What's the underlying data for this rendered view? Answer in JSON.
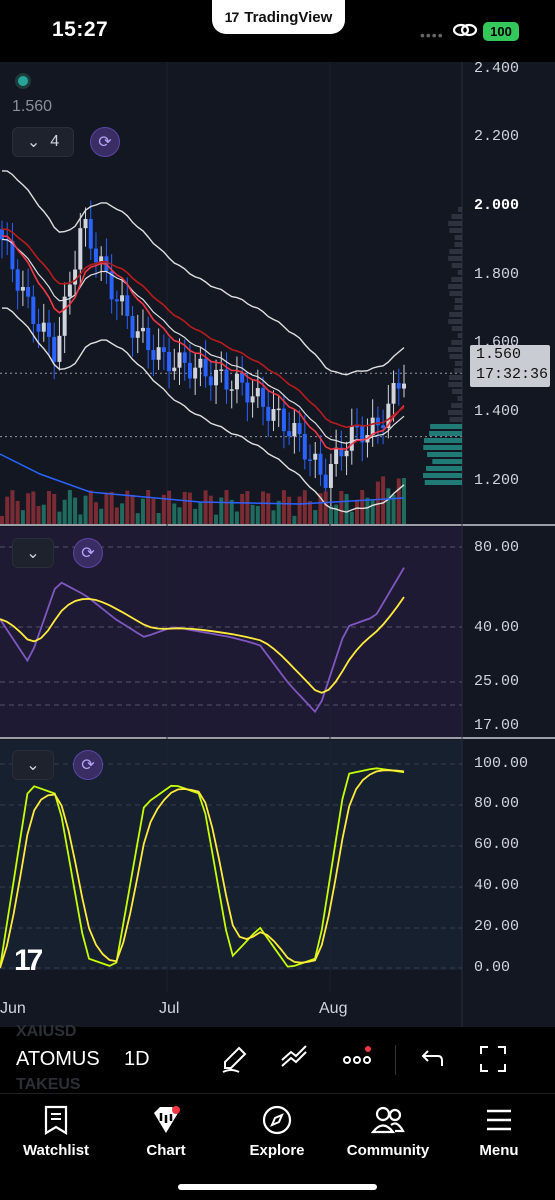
{
  "status_bar": {
    "time": "15:27",
    "app_pill": "TradingView",
    "battery": "100",
    "colors": {
      "battery": "#34c759"
    }
  },
  "chart": {
    "last_value_label": "1.560",
    "indicator_count": "4",
    "price_tag": {
      "price": "1.560",
      "countdown": "17:32:36"
    },
    "price_axis": [
      "2.400",
      "2.200",
      "2.000",
      "1.800",
      "1.600",
      "1.400",
      "1.200"
    ],
    "rsi_axis": [
      "80.00",
      "40.00",
      "25.00",
      "17.00"
    ],
    "stoch_axis": [
      "100.00",
      "80.00",
      "60.00",
      "40.00",
      "20.00",
      "0.00"
    ],
    "time_axis": [
      "Jun",
      "Jul",
      "Aug"
    ],
    "colors": {
      "up": "#26a69a",
      "down": "#2962ff",
      "ema": "#f23645",
      "rsi": "#7e57c2",
      "signal": "#ffeb3b",
      "stoch_k": "#c6ff00"
    }
  },
  "chart_data": [
    {
      "type": "line",
      "title": "",
      "ylim": [
        1.1,
        2.45
      ],
      "x": [
        "Jun",
        "Jul",
        "Aug"
      ],
      "series": [
        {
          "name": "",
          "values": [
            1.95,
            1.75,
            1.62,
            2.0,
            1.82,
            1.68,
            1.6,
            1.58,
            1.55,
            1.52,
            1.45,
            1.38,
            1.25,
            1.38,
            1.4,
            1.56
          ]
        }
      ]
    },
    {
      "type": "line",
      "ylim": [
        15,
        85
      ],
      "series": [
        {
          "name": "",
          "values": [
            55,
            38,
            70,
            64,
            55,
            48,
            52,
            50,
            48,
            45,
            30,
            18,
            52,
            56,
            75
          ]
        }
      ]
    },
    {
      "type": "line",
      "ylim": [
        0,
        100
      ],
      "series": [
        {
          "name": "",
          "values": [
            0,
            90,
            85,
            5,
            0,
            80,
            90,
            85,
            5,
            20,
            0,
            5,
            95,
            98,
            96
          ]
        }
      ]
    }
  ],
  "toolbar": {
    "ghost_top": "XAIUSD",
    "symbol": "ATOMUS",
    "ghost_bottom": "TAKEUS",
    "interval": "1D"
  },
  "tabs": [
    {
      "label": "Watchlist",
      "icon": "bookmark-icon"
    },
    {
      "label": "Chart",
      "icon": "chart-icon"
    },
    {
      "label": "Explore",
      "icon": "compass-icon"
    },
    {
      "label": "Community",
      "icon": "people-icon"
    },
    {
      "label": "Menu",
      "icon": "menu-icon"
    }
  ]
}
